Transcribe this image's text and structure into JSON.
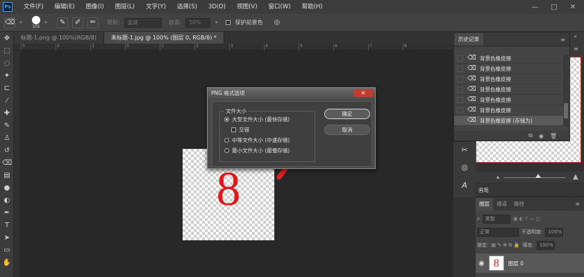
{
  "app": {
    "logo": "Ps",
    "menu": [
      "文件(F)",
      "编辑(E)",
      "图像(I)",
      "图层(L)",
      "文字(Y)",
      "选择(S)",
      "3D(D)",
      "视图(V)",
      "窗口(W)",
      "帮助(H)"
    ],
    "window_controls": [
      "—",
      "□",
      "✕"
    ]
  },
  "options_bar": {
    "brush_size": "101",
    "limit_label": "限制:",
    "limit_value": "连续",
    "tolerance_label": "容差:",
    "tolerance_value": "50%",
    "protect_label": "保护前景色"
  },
  "tabs": [
    {
      "label": "标题-1.png @ 100%(RGB/8)",
      "active": false
    },
    {
      "label": "未标题-1.jpg @ 100% (图层 0, RGB/8) *",
      "active": true
    }
  ],
  "ruler": {
    "labels": [
      "3",
      "2",
      "1",
      "0",
      "1",
      "2",
      "3",
      "4",
      "5",
      "6",
      "7",
      "8"
    ]
  },
  "canvas": {
    "digit": "8",
    "digit_color": "#e01818"
  },
  "dialog": {
    "title": "PNG 格式选项",
    "close": "✕",
    "group_label": "文件大小",
    "options": [
      {
        "label": "大型文件大小 (最快存储)",
        "selected": true
      },
      {
        "label": "中等文件大小 (中速存储)",
        "selected": false
      },
      {
        "label": "最小文件大小 (最慢存储)",
        "selected": false
      }
    ],
    "interlace_label": "交错",
    "ok_label": "确定",
    "cancel_label": "取消"
  },
  "history": {
    "tab_label": "历史记录",
    "menu_icon": "≡",
    "items": [
      {
        "label": "背景色橡皮擦",
        "selected": false
      },
      {
        "label": "背景色橡皮擦",
        "selected": false
      },
      {
        "label": "背景色橡皮擦",
        "selected": false
      },
      {
        "label": "背景色橡皮擦",
        "selected": false
      },
      {
        "label": "背景色橡皮擦",
        "selected": false
      },
      {
        "label": "背景色橡皮擦",
        "selected": false
      },
      {
        "label": "背景色橡皮擦 (存储为)",
        "selected": true
      }
    ]
  },
  "brush_panel": {
    "tab_label": "画笔"
  },
  "layers": {
    "tabs": [
      {
        "label": "图层",
        "active": true
      },
      {
        "label": "通道",
        "active": false
      },
      {
        "label": "路径",
        "active": false
      }
    ],
    "kind_label": "类型",
    "blend_mode": "正常",
    "opacity_label": "不透明度:",
    "opacity_value": "100%",
    "lock_label": "锁定:",
    "fill_label": "填充:",
    "fill_value": "100%",
    "layer_name": "图层 0",
    "layer_thumb": "8"
  },
  "colors": {
    "arrow": "#e02020",
    "accent_red": "#c0392b"
  }
}
